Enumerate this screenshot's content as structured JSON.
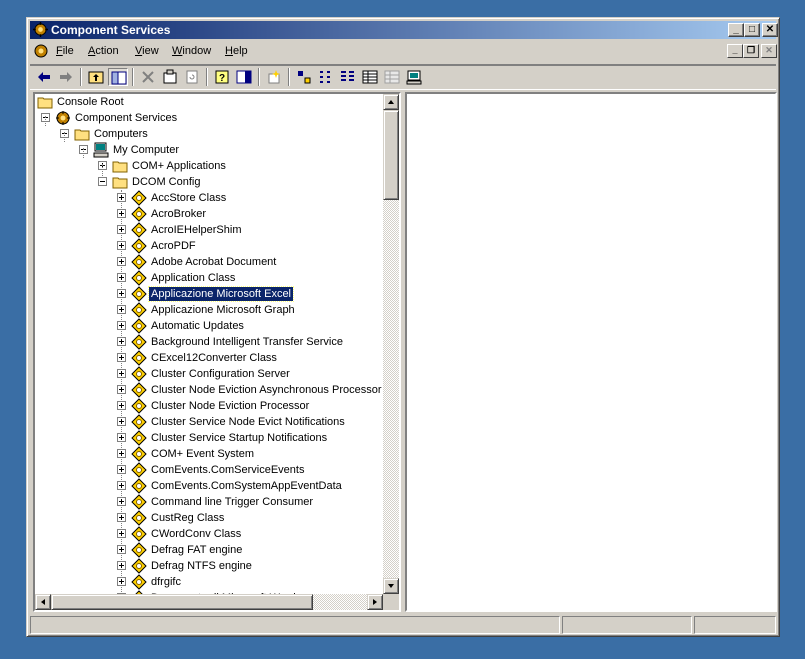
{
  "window": {
    "title": "Component Services"
  },
  "menu": [
    {
      "label": "File",
      "u": "F",
      "rest": "ile"
    },
    {
      "label": "Action",
      "u": "A",
      "rest": "ction"
    },
    {
      "label": "View",
      "u": "V",
      "rest": "iew"
    },
    {
      "label": "Window",
      "u": "W",
      "rest": "indow"
    },
    {
      "label": "Help",
      "u": "H",
      "rest": "elp"
    }
  ],
  "toolbar": [
    "back-icon",
    "forward-icon",
    "up-level-icon",
    "show-hide-tree-icon",
    "delete-icon",
    "properties-icon",
    "refresh-icon",
    "help-icon",
    "export-list-icon",
    "new-window-icon",
    "large-icons-icon",
    "small-icons-icon",
    "list-icon",
    "detail-icon",
    "details-disabled-icon",
    "computer-view-icon"
  ],
  "tree": {
    "console_root": "Console Root",
    "component_services": "Component Services",
    "computers": "Computers",
    "my_computer": "My Computer",
    "com_apps": "COM+ Applications",
    "dcom_config": "DCOM Config",
    "items": [
      "AccStore Class",
      "AcroBroker",
      "AcroIEHelperShim",
      "AcroPDF",
      "Adobe Acrobat Document",
      "Application Class",
      "Applicazione Microsoft Excel",
      "Applicazione Microsoft Graph",
      "Automatic Updates",
      "Background Intelligent Transfer Service",
      "CExcel12Converter Class",
      "Cluster Configuration Server",
      "Cluster Node Eviction Asynchronous Processor",
      "Cluster Node Eviction Processor",
      "Cluster Service Node Evict Notifications",
      "Cluster Service Startup Notifications",
      "COM+ Event System",
      "ComEvents.ComServiceEvents",
      "ComEvents.ComSystemAppEventData",
      "Command line Trigger Consumer",
      "CustReg Class",
      "CWordConv Class",
      "Defrag FAT engine",
      "Defrag NTFS engine",
      "dfrgifc",
      "Documento di Microsoft Word"
    ],
    "selected": "Applicazione Microsoft Excel"
  }
}
